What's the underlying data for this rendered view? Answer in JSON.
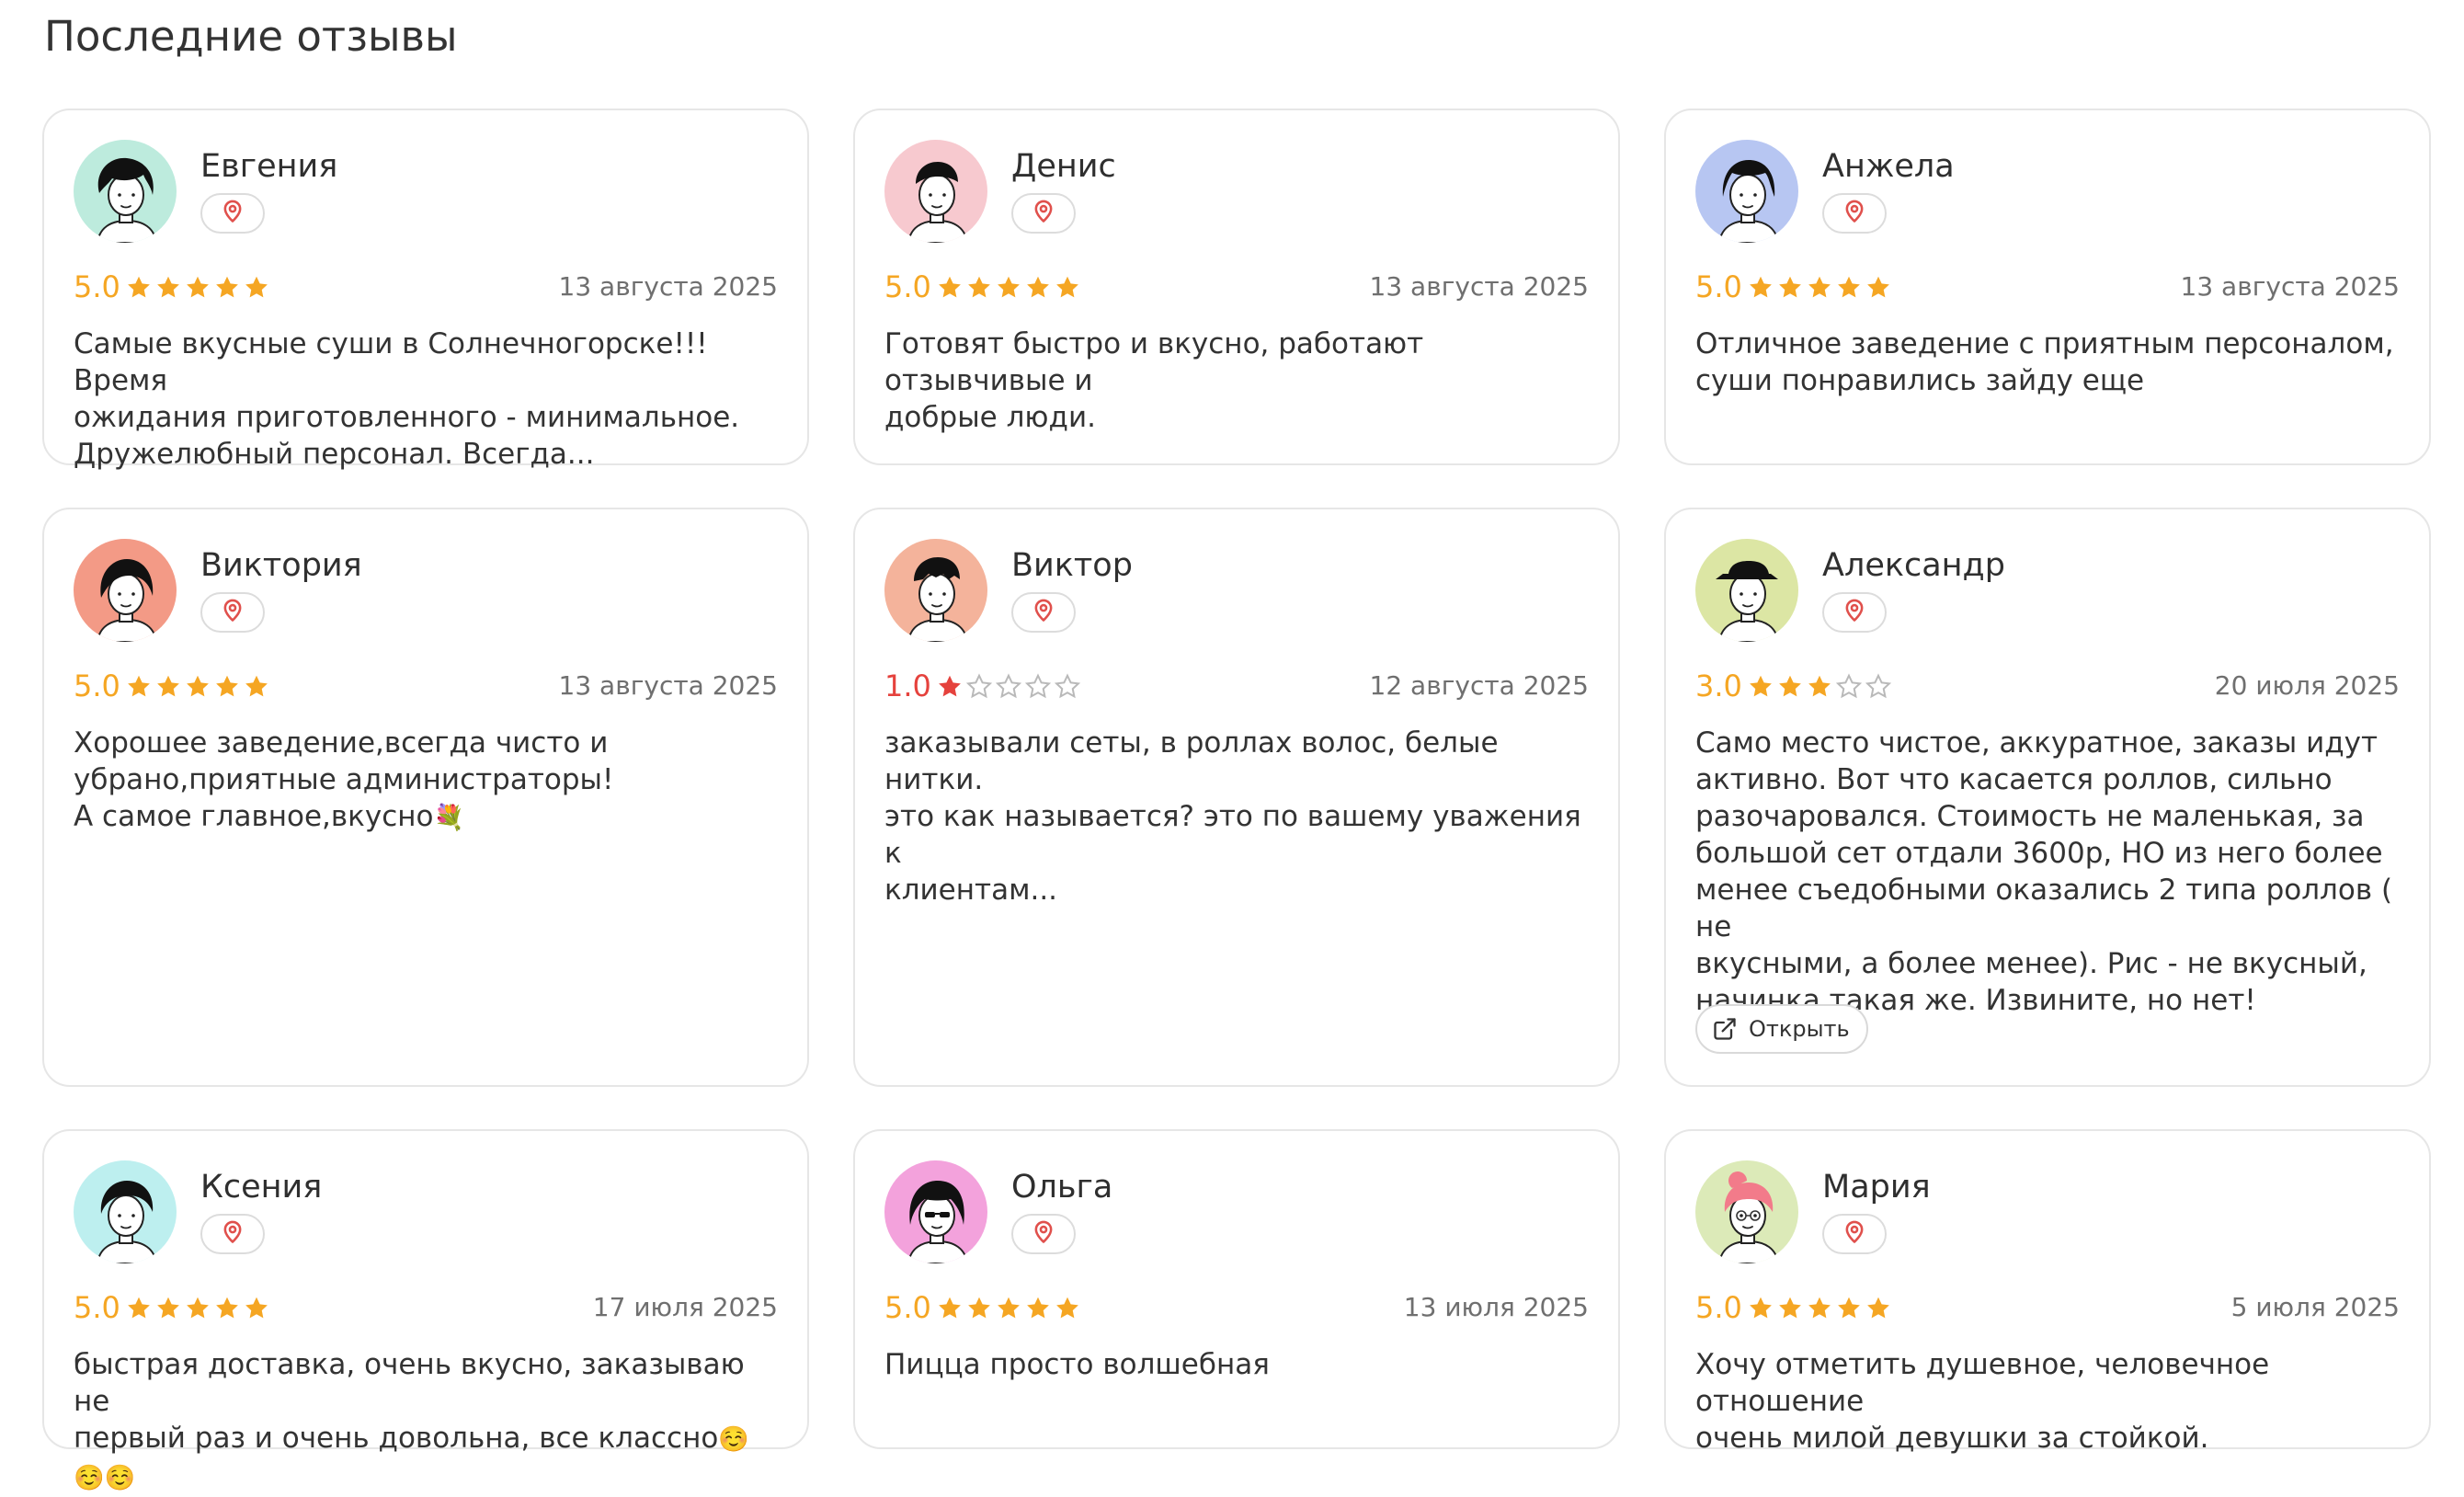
{
  "page": {
    "title": "Последние отзывы"
  },
  "colors": {
    "star_gold": "#F5A623",
    "rating_gold": "#F5A623",
    "rating_red": "#E5423D",
    "pin_red": "#E0504C",
    "star_empty": "#B9B9B9"
  },
  "icons": {
    "location": "map-pin-icon",
    "star": "star-icon",
    "open": "external-link-icon"
  },
  "reviews": [
    {
      "name": "Евгения",
      "rating": "5.0",
      "stars": 5,
      "date": "13 августа 2025",
      "text": "Самые вкусные суши в Солнечногорске!!! Время\nожидания приготовленного - минимальное.\nДружелюбный персонал. Всегда...",
      "avatar_bg": "#BDEBDD"
    },
    {
      "name": "Денис",
      "rating": "5.0",
      "stars": 5,
      "date": "13 августа 2025",
      "text": "Готовят быстро и вкусно, работают отзывчивые и\nдобрые люди.",
      "avatar_bg": "#F7C9CF"
    },
    {
      "name": "Анжела",
      "rating": "5.0",
      "stars": 5,
      "date": "13 августа 2025",
      "text": "Отличное заведение с приятным персоналом,\nсуши понравились зайду еще",
      "avatar_bg": "#B7C6F2"
    },
    {
      "name": "Виктория",
      "rating": "5.0",
      "stars": 5,
      "date": "13 августа 2025",
      "text": "Хорошее заведение,всегда чисто и\nубрано,приятные администраторы!\nА самое главное,вкусно",
      "emoji": "💐",
      "avatar_bg": "#F39A86"
    },
    {
      "name": "Виктор",
      "rating": "1.0",
      "stars": 1,
      "date": "12 августа 2025",
      "text": "заказывали сеты, в роллах волос, белые нитки.\nэто как называется? это по вашему уважения к\nклиентам...",
      "avatar_bg": "#F4B39B"
    },
    {
      "name": "Александр",
      "rating": "3.0",
      "stars": 3,
      "date": "20 июля 2025",
      "text": "Само место чистое, аккуратное, заказы идут\nактивно. Вот что касается роллов, сильно\nразочаровался. Стоимость не маленькая, за\nбольшой сет отдали 3600р, НО из него более\nменее съедобными оказались 2 типа роллов ( не\nвкусными, а более менее). Рис - не вкусный,\nначинка такая же. Извините, но нет!",
      "open_label": "Открыть",
      "avatar_bg": "#DCE6A4"
    },
    {
      "name": "Ксения",
      "rating": "5.0",
      "stars": 5,
      "date": "17 июля 2025",
      "text": "быстрая доставка, очень вкусно, заказываю не\nпервый раз и очень довольна, все классно",
      "emoji": "☺️☺️☺️",
      "avatar_bg": "#BDEFEF"
    },
    {
      "name": "Ольга",
      "rating": "5.0",
      "stars": 5,
      "date": "13 июля 2025",
      "text": "Пицца просто волшебная",
      "avatar_bg": "#F3A2DC"
    },
    {
      "name": "Мария",
      "rating": "5.0",
      "stars": 5,
      "date": "5 июля 2025",
      "text": "Хочу отметить душевное, человечное отношение\nочень милой девушки за стойкой.",
      "avatar_bg": "#DCEAB8"
    }
  ]
}
